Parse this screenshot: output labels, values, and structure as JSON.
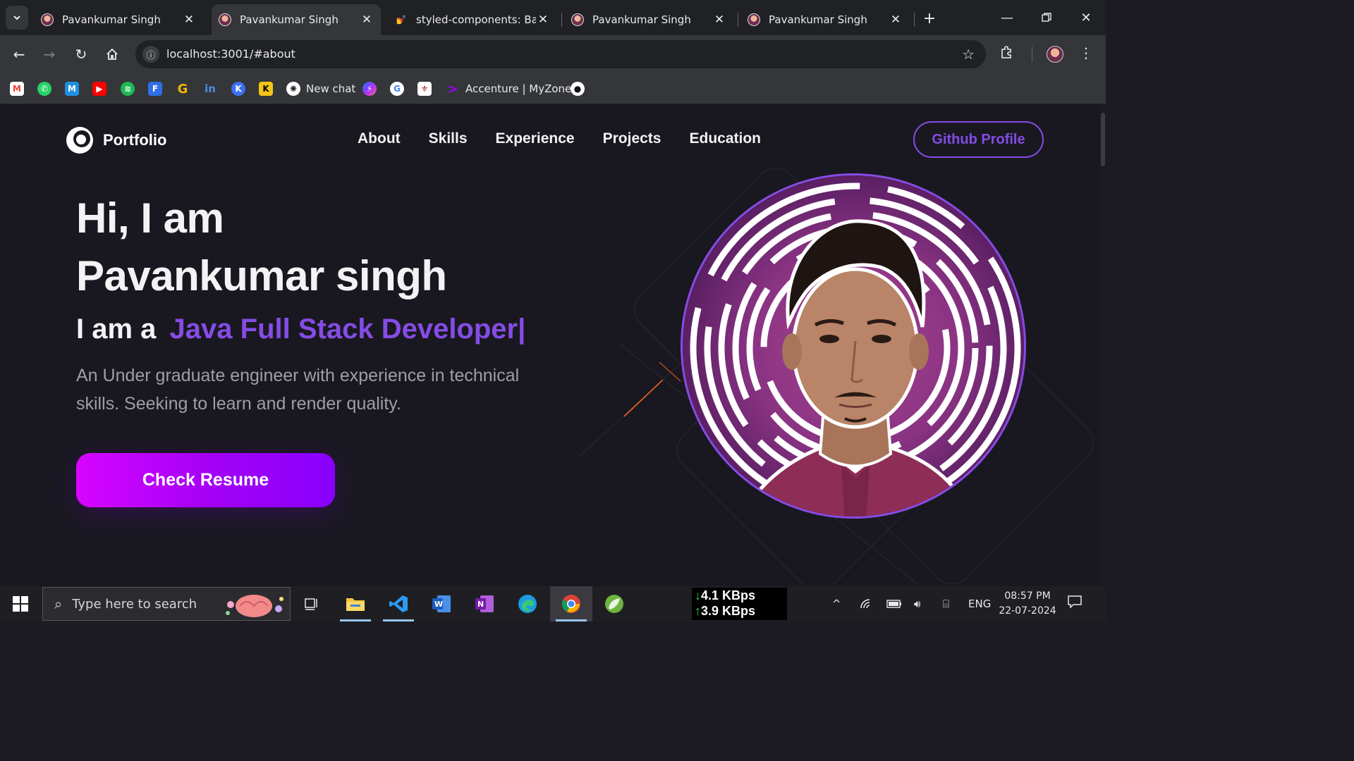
{
  "browser": {
    "tabs": [
      {
        "title": "Pavankumar Singh",
        "active": false,
        "favicon": "avatar-favicon"
      },
      {
        "title": "Pavankumar Singh",
        "active": true,
        "favicon": "avatar-favicon"
      },
      {
        "title": "styled-components: Basic",
        "active": false,
        "favicon": "styled-components-favicon"
      },
      {
        "title": "Pavankumar Singh",
        "active": false,
        "favicon": "avatar-favicon"
      },
      {
        "title": "Pavankumar Singh",
        "active": false,
        "favicon": "avatar-favicon"
      }
    ],
    "url": "localhost:3001/#about",
    "bookmarks": [
      {
        "name": "gmail-icon",
        "label": ""
      },
      {
        "name": "whatsapp-icon",
        "label": ""
      },
      {
        "name": "bookmark-m-icon",
        "label": ""
      },
      {
        "name": "youtube-icon",
        "label": ""
      },
      {
        "name": "spotify-icon",
        "label": ""
      },
      {
        "name": "bookmark-f-icon",
        "label": ""
      },
      {
        "name": "bookmark-g-icon",
        "label": ""
      },
      {
        "name": "linkedin-icon",
        "label": ""
      },
      {
        "name": "bookmark-k-blue-icon",
        "label": ""
      },
      {
        "name": "bookmark-k-icon",
        "label": ""
      },
      {
        "name": "openai-icon",
        "label": "New chat"
      },
      {
        "name": "messenger-icon",
        "label": ""
      },
      {
        "name": "google-icon",
        "label": ""
      },
      {
        "name": "bookmark-emblem-icon",
        "label": ""
      },
      {
        "name": "accenture-icon",
        "label": "Accenture | MyZone"
      },
      {
        "name": "github-icon",
        "label": ""
      }
    ]
  },
  "site": {
    "logo_text": "Portfolio",
    "nav": [
      "About",
      "Skills",
      "Experience",
      "Projects",
      "Education"
    ],
    "github_button": "Github Profile",
    "hero": {
      "greeting": "Hi, I am",
      "name": "Pavankumar singh",
      "role_prefix": "I am a",
      "role": "Java Full Stack Developer",
      "cursor": "|",
      "description": "An Under graduate engineer with experience in technical skills. Seeking to learn and render quality.",
      "resume_button": "Check Resume"
    },
    "colors": {
      "accent": "#854ce6",
      "background": "#191820",
      "button_gradient_start": "#d605ff",
      "button_gradient_end": "#8800ff"
    }
  },
  "taskbar": {
    "search_placeholder": "Type here to search",
    "net_down": "4.1 KBps",
    "net_up": "3.9 KBps",
    "language": "ENG",
    "time": "08:57 PM",
    "date": "22-07-2024"
  }
}
